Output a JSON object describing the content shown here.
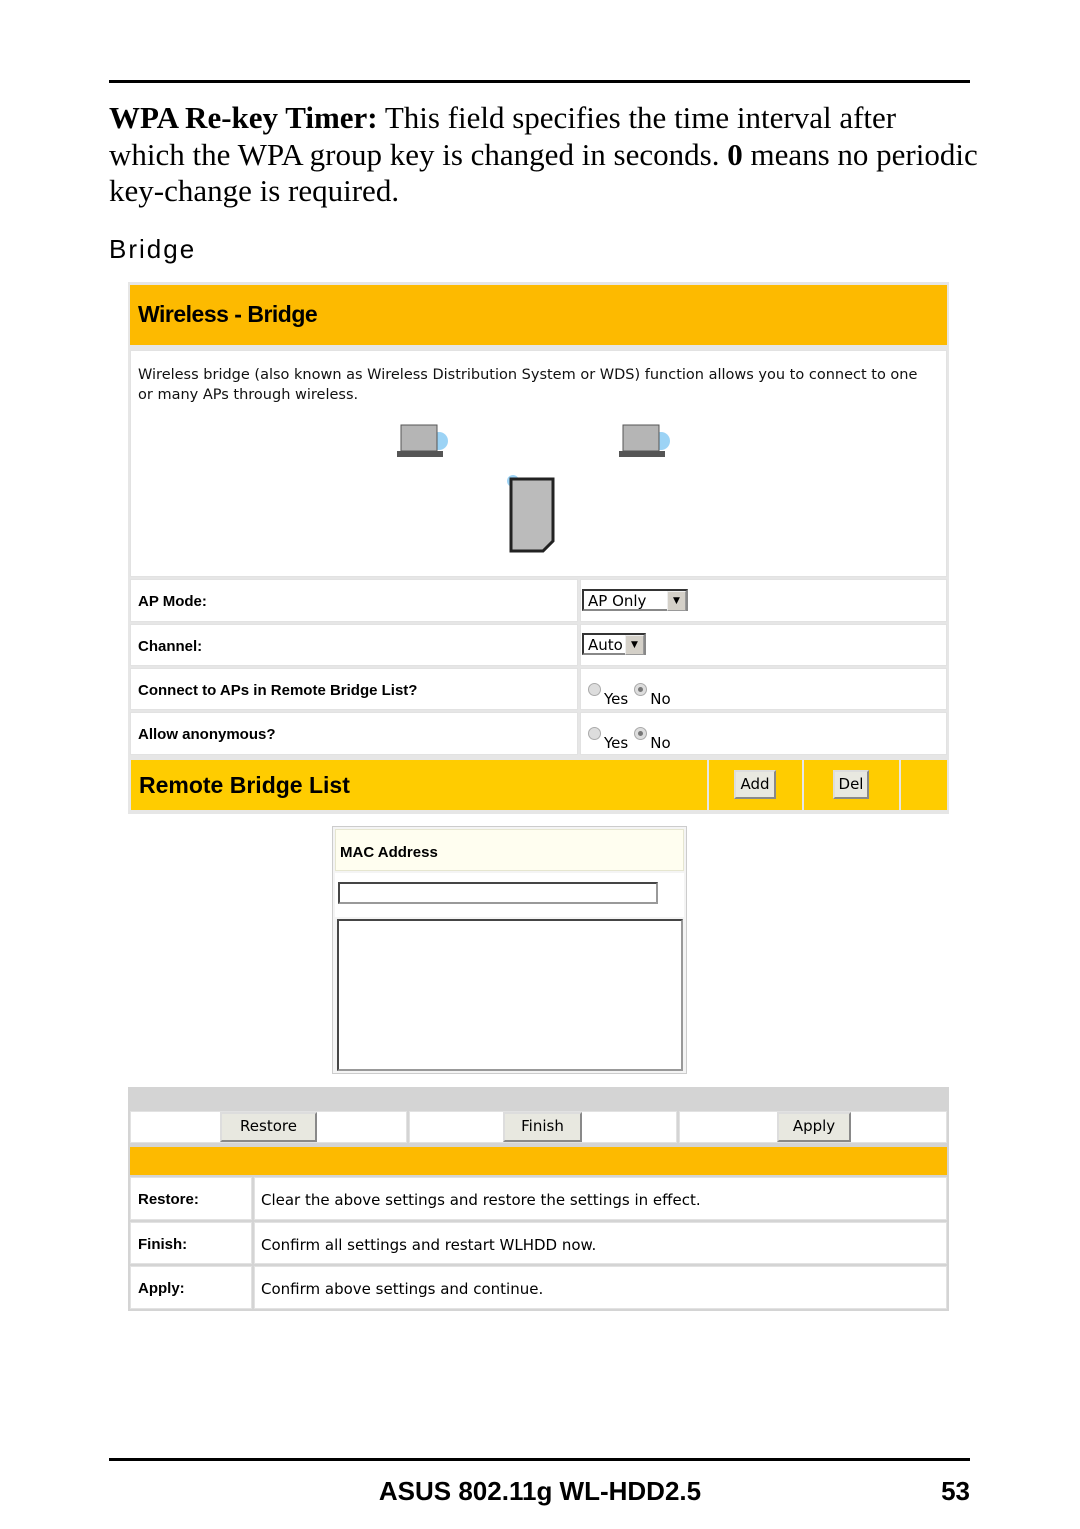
{
  "doc": {
    "term": "WPA Re-key Timer:",
    "para_a": " This field specifies the time interval after which the WPA group key is changed in seconds. ",
    "zero": "0",
    "para_b": " means no periodic key-change is required.",
    "section": "Bridge"
  },
  "ui": {
    "title": "Wireless - Bridge",
    "description": "Wireless bridge (also known as Wireless Distribution System or WDS) function allows you to connect to one or many APs through wireless.",
    "fields": [
      {
        "label": "AP Mode:",
        "value": "AP Only"
      },
      {
        "label": "Channel:",
        "value": "Auto"
      },
      {
        "label": "Connect to APs in Remote Bridge List?",
        "yes": "Yes",
        "no": "No",
        "selected": "No"
      },
      {
        "label": "Allow anonymous?",
        "yes": "Yes",
        "no": "No",
        "selected": "No"
      }
    ],
    "remote": {
      "title": "Remote Bridge List",
      "add": "Add",
      "del": "Del",
      "mac_header": "MAC Address",
      "mac_value": ""
    },
    "buttons": {
      "restore": "Restore",
      "finish": "Finish",
      "apply": "Apply"
    },
    "help": [
      {
        "label": "Restore:",
        "text": "Clear the above settings and restore the settings in effect."
      },
      {
        "label": "Finish:",
        "text": "Confirm all settings and restart WLHDD now."
      },
      {
        "label": "Apply:",
        "text": "Confirm above settings and continue."
      }
    ],
    "colors": {
      "header": "#FDBA00",
      "list_header": "#FFCC00"
    }
  },
  "footer": {
    "title": "ASUS 802.11g WL-HDD2.5",
    "page": "53"
  }
}
